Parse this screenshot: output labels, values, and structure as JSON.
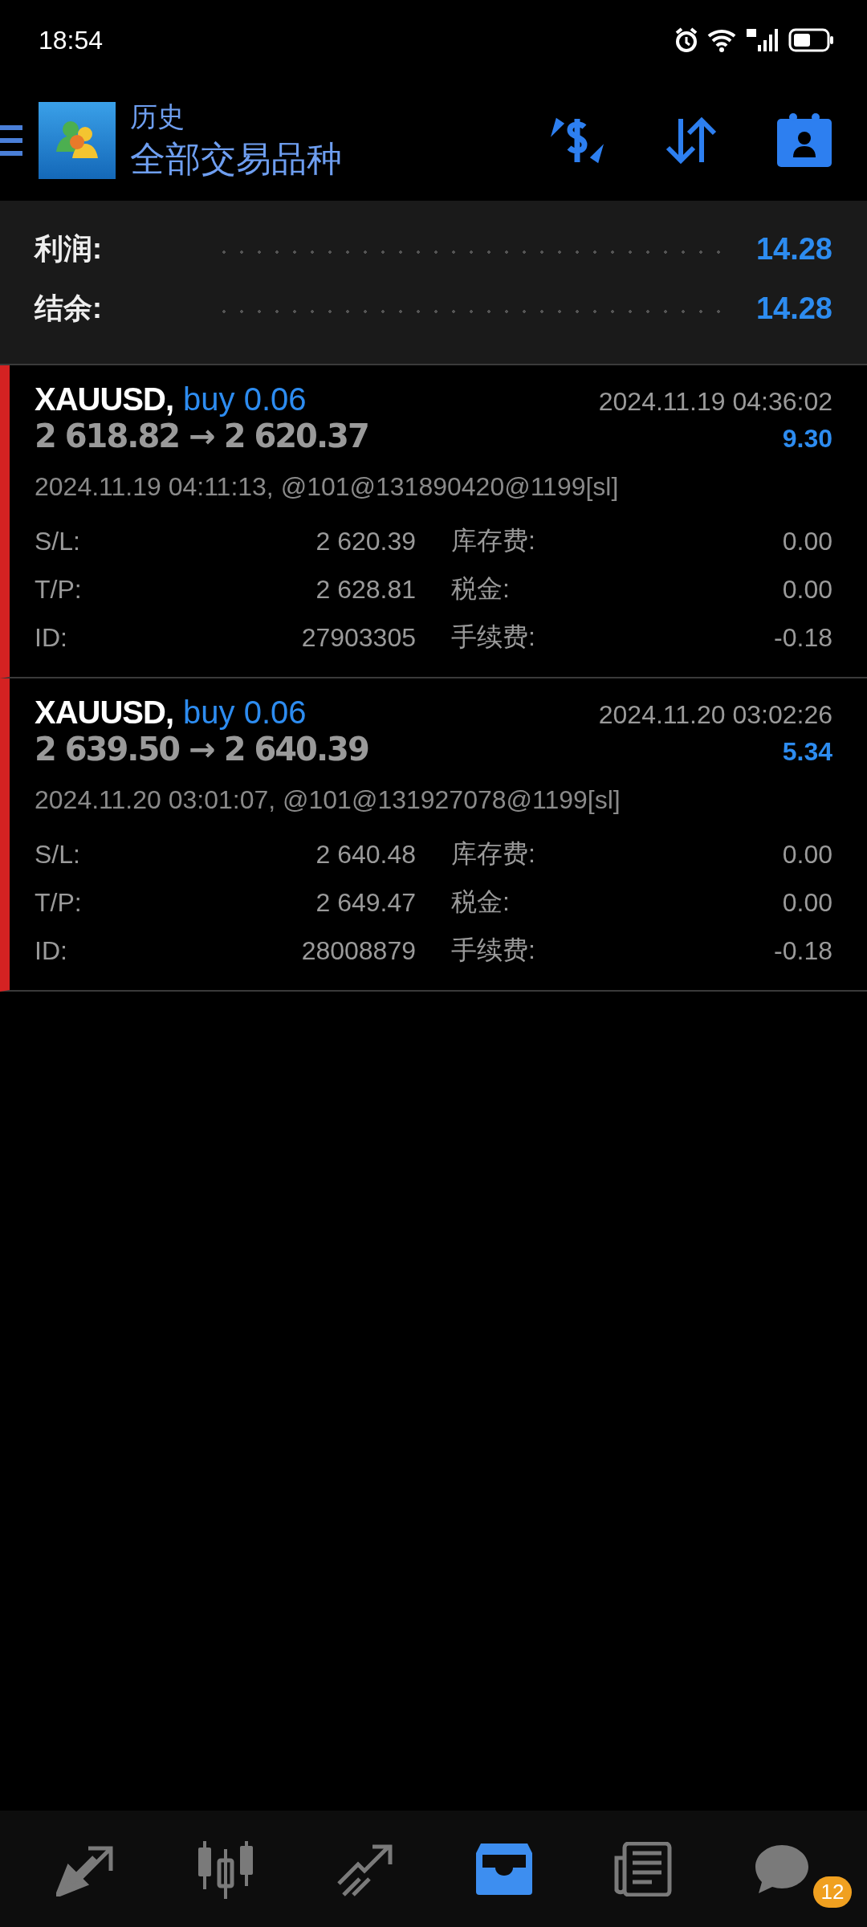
{
  "status_bar": {
    "time": "18:54"
  },
  "header": {
    "title": "历史",
    "subtitle": "全部交易品种"
  },
  "summary": [
    {
      "label": "利润:",
      "value": "14.28"
    },
    {
      "label": "结余:",
      "value": "14.28"
    }
  ],
  "trades": [
    {
      "symbol": "XAUUSD,",
      "side": "buy 0.06",
      "open_price": "2 618.82",
      "arrow": "→",
      "close_price": "2 620.37",
      "close_time": "2024.11.19 04:36:02",
      "profit": "9.30",
      "comment": "2024.11.19 04:11:13, @101@131890420@1199[sl]",
      "details": [
        {
          "label": "S/L:",
          "value": "2 620.39",
          "fee_label": "库存费:",
          "fee_value": "0.00"
        },
        {
          "label": "T/P:",
          "value": "2 628.81",
          "fee_label": "税金:",
          "fee_value": "0.00"
        },
        {
          "label": "ID:",
          "value": "27903305",
          "fee_label": "手续费:",
          "fee_value": "-0.18"
        }
      ]
    },
    {
      "symbol": "XAUUSD,",
      "side": "buy 0.06",
      "open_price": "2 639.50",
      "arrow": "→",
      "close_price": "2 640.39",
      "close_time": "2024.11.20 03:02:26",
      "profit": "5.34",
      "comment": "2024.11.20 03:01:07, @101@131927078@1199[sl]",
      "details": [
        {
          "label": "S/L:",
          "value": "2 640.48",
          "fee_label": "库存费:",
          "fee_value": "0.00"
        },
        {
          "label": "T/P:",
          "value": "2 649.47",
          "fee_label": "税金:",
          "fee_value": "0.00"
        },
        {
          "label": "ID:",
          "value": "28008879",
          "fee_label": "手续费:",
          "fee_value": "-0.18"
        }
      ]
    }
  ],
  "bottom_nav": [
    {
      "kind": "quotes",
      "selected": false
    },
    {
      "kind": "chart",
      "selected": false
    },
    {
      "kind": "trade",
      "selected": false
    },
    {
      "kind": "history",
      "selected": true
    },
    {
      "kind": "news",
      "selected": false
    },
    {
      "kind": "chat",
      "selected": false,
      "badge": "12"
    }
  ]
}
